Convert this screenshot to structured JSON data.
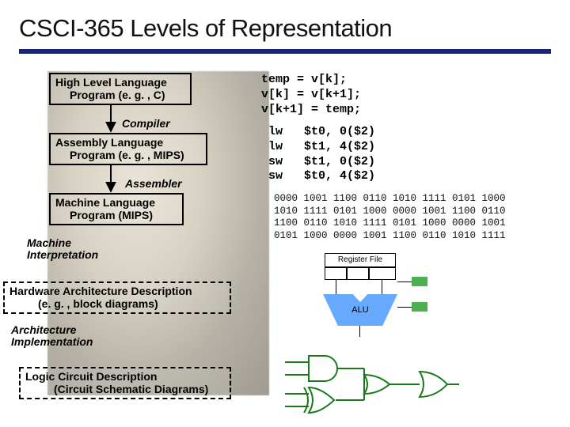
{
  "title": "CSCI-365 Levels of Representation",
  "levels": {
    "hll": {
      "l1": "High Level Language",
      "l2": "Program (e. g. , C)"
    },
    "asm": {
      "l1": "Assembly  Language",
      "l2": "Program (e. g. , MIPS)"
    },
    "mach": {
      "l1": "Machine  Language",
      "l2": "Program (MIPS)"
    },
    "hw": {
      "l1": "Hardware Architecture Description",
      "l2": "(e. g. , block diagrams)"
    },
    "logic": {
      "l1": "Logic Circuit Description",
      "l2": "(Circuit Schematic Diagrams)"
    }
  },
  "steps": {
    "compiler": "Compiler",
    "assembler": "Assembler",
    "machine_interp_l1": "Machine",
    "machine_interp_l2": "Interpretation",
    "arch_impl_l1": "Architecture",
    "arch_impl_l2": "Implementation"
  },
  "code_c": "temp = v[k];\nv[k] = v[k+1];\nv[k+1] = temp;",
  "code_asm": " lw   $t0, 0($2)\n lw   $t1, 4($2)\n sw   $t1, 0($2)\n sw   $t0, 4($2)",
  "code_bin": "0000 1001 1100 0110 1010 1111 0101 1000\n1010 1111 0101 1000 0000 1001 1100 0110\n1100 0110 1010 1111 0101 1000 0000 1001\n0101 1000 0000 1001 1100 0110 1010 1111",
  "diagram": {
    "regfile": "Register File",
    "alu": "ALU"
  }
}
